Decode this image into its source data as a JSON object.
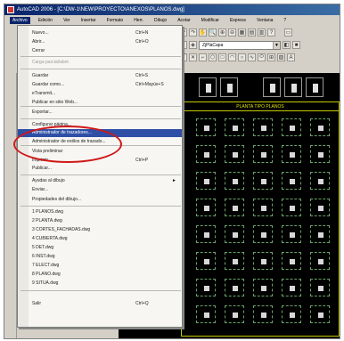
{
  "window": {
    "title": "AutoCAD 2006 - [C:\\DW-1\\NEW\\PROYECTO\\ANEXOS\\PLANOS.dwg]"
  },
  "menubar": {
    "items": [
      "Archivo",
      "Edición",
      "Ver",
      "Insertar",
      "Formato",
      "Herr.",
      "Dibujo",
      "Acotar",
      "Modificar",
      "Express",
      "Ventana",
      "?"
    ]
  },
  "toolbar": {
    "layer_combo": "ZjPlaCapa"
  },
  "file_menu": {
    "entries": [
      {
        "label": "Nuevo...",
        "shortcut": "Ctrl+N",
        "disabled": false
      },
      {
        "label": "Abrir...",
        "shortcut": "Ctrl+O",
        "disabled": false
      },
      {
        "label": "Cerrar",
        "shortcut": "",
        "disabled": false
      },
      {
        "label": "Carga parcial/abrir",
        "shortcut": "",
        "disabled": true
      },
      {
        "label": "Guardar",
        "shortcut": "Ctrl+S",
        "disabled": false
      },
      {
        "label": "Guardar como...",
        "shortcut": "Ctrl+Mayús+S",
        "disabled": false
      },
      {
        "label": "eTransmit...",
        "shortcut": "",
        "disabled": false
      },
      {
        "label": "Publicar en sitio Web...",
        "shortcut": "",
        "disabled": false
      },
      {
        "label": "Exportar...",
        "shortcut": "",
        "disabled": false
      },
      {
        "label": "Configurar página...",
        "shortcut": "",
        "disabled": false
      },
      {
        "label": "Administrador de trazadores...",
        "shortcut": "",
        "disabled": false,
        "highlight": true
      },
      {
        "label": "Administrador de estilos de trazado...",
        "shortcut": "",
        "disabled": false
      },
      {
        "label": "Vista preliminar",
        "shortcut": "",
        "disabled": false
      },
      {
        "label": "Imprimir...",
        "shortcut": "Ctrl+P",
        "disabled": false
      },
      {
        "label": "Publicar...",
        "shortcut": "",
        "disabled": false
      },
      {
        "label": "Ayudas al dibujo",
        "shortcut": "",
        "disabled": false,
        "submenu": true
      },
      {
        "label": "Enviar...",
        "shortcut": "",
        "disabled": false
      },
      {
        "label": "Propiedades del dibujo...",
        "shortcut": "",
        "disabled": false
      },
      {
        "label": "1 PLANOS.dwg",
        "shortcut": "",
        "disabled": false
      },
      {
        "label": "2 PLANTA.dwg",
        "shortcut": "",
        "disabled": false
      },
      {
        "label": "3 CORTES_FACHADAS.dwg",
        "shortcut": "",
        "disabled": false
      },
      {
        "label": "4 CUBIERTA.dwg",
        "shortcut": "",
        "disabled": false
      },
      {
        "label": "5 DET.dwg",
        "shortcut": "",
        "disabled": false
      },
      {
        "label": "6 INST.dwg",
        "shortcut": "",
        "disabled": false
      },
      {
        "label": "7 ELECT.dwg",
        "shortcut": "",
        "disabled": false
      },
      {
        "label": "8 PLANO.dwg",
        "shortcut": "",
        "disabled": false
      },
      {
        "label": "9 SITUA.dwg",
        "shortcut": "",
        "disabled": false
      },
      {
        "label": "Salir",
        "shortcut": "Ctrl+Q",
        "disabled": false
      }
    ]
  },
  "drawing": {
    "schedule_title": "PLANTA TIPO PLANOS"
  },
  "colors": {
    "highlight": "#2f4fa6",
    "annotation_ellipse": "#d01818",
    "canvas": "#000000",
    "schedule_lines": "#c8c800"
  },
  "icons": [
    "app-icon",
    "save-icon",
    "print-icon",
    "zoom-icon",
    "pan-icon",
    "layer-icon",
    "submenu-arrow-icon"
  ]
}
